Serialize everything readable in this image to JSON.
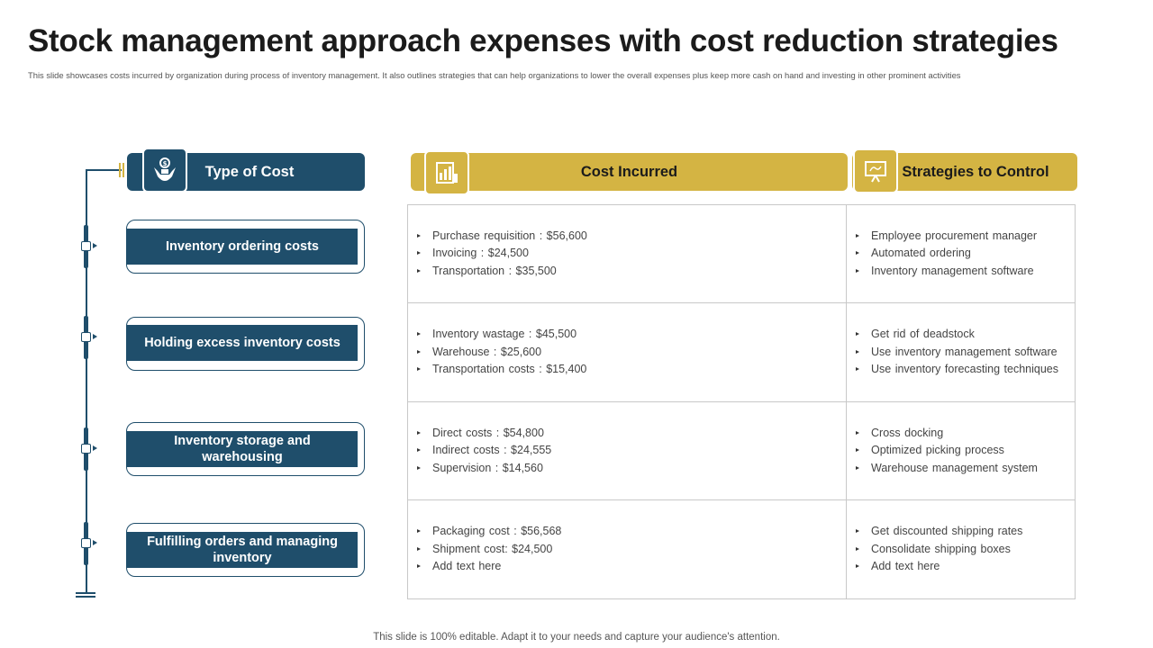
{
  "title": "Stock management approach expenses with cost reduction strategies",
  "subtitle": "This slide showcases costs incurred by organization during process of inventory management. It also outlines strategies that can help organizations to lower the overall expenses plus keep more cash on hand and investing in other prominent activities",
  "headers": {
    "type": "Type of Cost",
    "cost": "Cost Incurred",
    "strategies": "Strategies to Control"
  },
  "icons": {
    "type": "hand-money-icon",
    "cost": "chart-report-icon",
    "strategies": "presentation-board-icon"
  },
  "colors": {
    "navy": "#1f4e6b",
    "gold": "#d4b443"
  },
  "rows": [
    {
      "type": "Inventory ordering costs",
      "costs": [
        "Purchase requisition : $56,600",
        "Invoicing  : $24,500",
        "Transportation  : $35,500"
      ],
      "strategies": [
        "Employee procurement manager",
        "Automated ordering",
        "Inventory  management  software"
      ]
    },
    {
      "type": "Holding excess inventory costs",
      "costs": [
        "Inventory  wastage  : $45,500",
        "Warehouse  : $25,600",
        "Transportation  costs : $15,400"
      ],
      "strategies": [
        "Get rid of deadstock",
        "Use inventory  management software",
        "Use inventory  forecasting techniques"
      ]
    },
    {
      "type": "Inventory storage and warehousing",
      "costs": [
        "Direct costs : $54,800",
        "Indirect costs : $24,555",
        "Supervision  : $14,560"
      ],
      "strategies": [
        "Cross docking",
        "Optimized picking process",
        "Warehouse management system"
      ]
    },
    {
      "type": "Fulfilling orders and managing inventory",
      "costs": [
        "Packaging cost : $56,568",
        "Shipment cost: $24,500",
        "Add text here"
      ],
      "strategies": [
        "Get discounted shipping rates",
        "Consolidate  shipping boxes",
        "Add text here"
      ]
    }
  ],
  "footer": "This slide is 100% editable. Adapt it to your needs and capture your audience's attention."
}
